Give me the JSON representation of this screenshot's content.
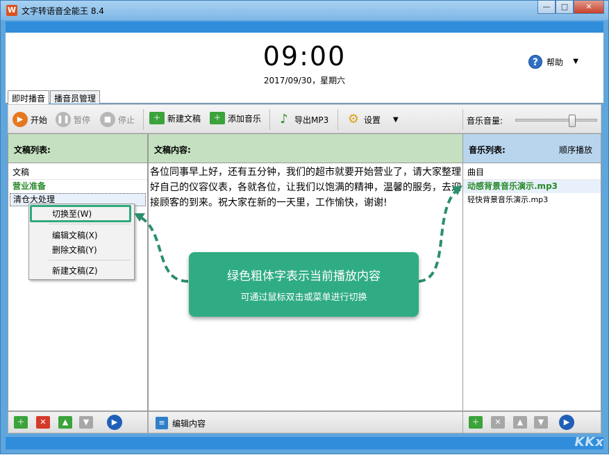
{
  "window": {
    "title": "文字转语音全能王 8.4",
    "app_icon_glyph": "W",
    "min_glyph": "—",
    "max_glyph": "□",
    "close_glyph": "✕"
  },
  "header": {
    "clock": "09:00",
    "date": "2017/09/30，星期六",
    "help_label": "帮助",
    "help_glyph": "?",
    "help_arrow": "▼"
  },
  "tabs": [
    {
      "label": "即时播音"
    },
    {
      "label": "播音员管理"
    }
  ],
  "toolbar": {
    "start": "开始",
    "pause": "暂停",
    "stop": "停止",
    "new_script": "新建文稿",
    "add_music": "添加音乐",
    "export_mp3": "导出MP3",
    "settings": "设置",
    "settings_arrow": "▼",
    "music_volume": "音乐音量:",
    "volume_level": 0.72
  },
  "scripts_panel": {
    "title": "文稿列表:",
    "header": "文稿",
    "items": [
      {
        "label": "营业准备",
        "state": "playing"
      },
      {
        "label": "清仓大处理",
        "state": "selected"
      }
    ]
  },
  "content_panel": {
    "title": "文稿内容:",
    "text": "各位同事早上好，还有五分钟，我们的超市就要开始营业了，请大家整理好自己的仪容仪表，各就各位，让我们以饱满的精神，温馨的服务，去迎接顾客的到来。祝大家在新的一天里，工作愉快，谢谢!",
    "bottom_label": "编辑内容"
  },
  "music_panel": {
    "title": "音乐列表:",
    "mode": "顺序播放",
    "header": "曲目",
    "items": [
      {
        "label": "动感背景音乐演示.mp3",
        "state": "playing"
      },
      {
        "label": "轻快背景音乐演示.mp3",
        "state": "normal"
      }
    ]
  },
  "context_menu": {
    "switch_to": "切换至(W)",
    "edit": "编辑文稿(X)",
    "delete": "删除文稿(Y)",
    "new": "新建文稿(Z)"
  },
  "callout": {
    "title": "绿色粗体字表示当前播放内容",
    "subtitle": "可通过鼠标双击或菜单进行切换"
  },
  "colors": {
    "playing": "#2a8a2a",
    "callout": "#30ac84",
    "accent_blue": "#2f8ddc"
  },
  "watermark": "KKx"
}
